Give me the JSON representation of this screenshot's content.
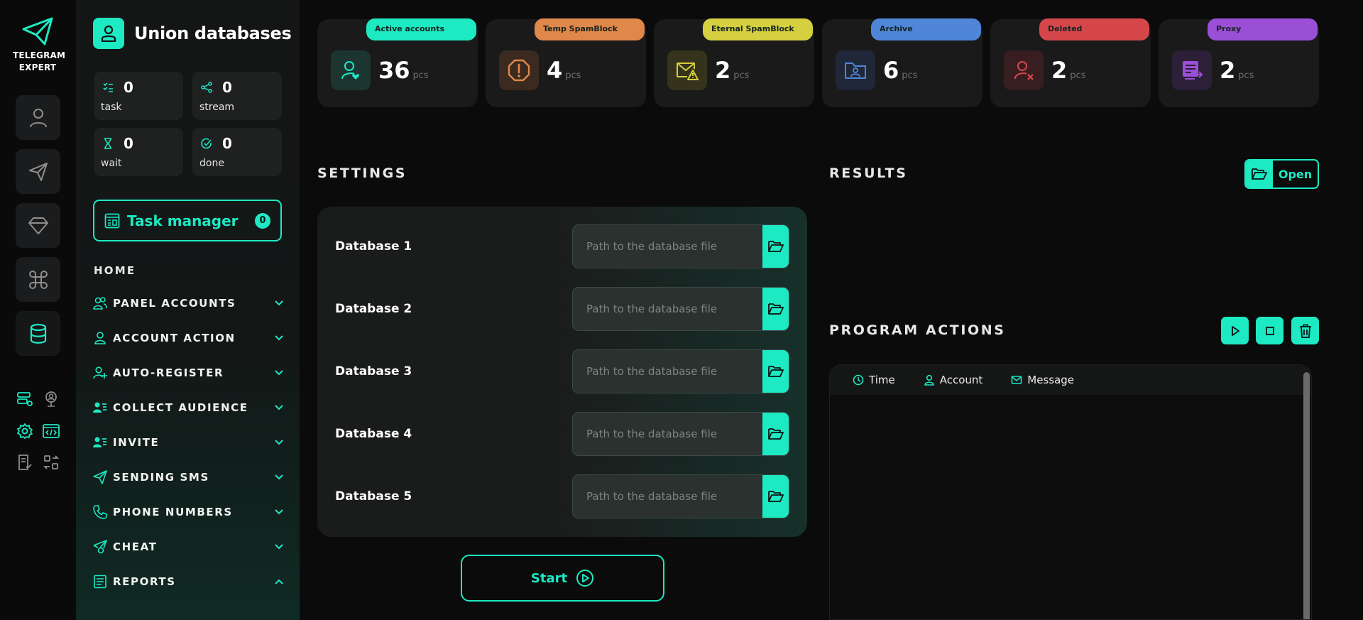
{
  "app": {
    "logo_line1": "TELEGRAM",
    "logo_line2": "EXPERT"
  },
  "sidebar": {
    "title": "Union databases",
    "stats": [
      {
        "value": "0",
        "label": "task",
        "icon": "list-icon"
      },
      {
        "value": "0",
        "label": "stream",
        "icon": "share-icon"
      },
      {
        "value": "0",
        "label": "wait",
        "icon": "hourglass-icon"
      },
      {
        "value": "0",
        "label": "done",
        "icon": "check-circle-icon"
      }
    ],
    "task_manager": {
      "label": "Task manager",
      "count": "0"
    },
    "home_label": "HOME",
    "nav": [
      {
        "label": "PANEL ACCOUNTS",
        "icon": "users-icon",
        "expanded": false
      },
      {
        "label": "ACCOUNT ACTION",
        "icon": "user-icon",
        "expanded": false
      },
      {
        "label": "AUTO-REGISTER",
        "icon": "user-plus-icon",
        "expanded": false
      },
      {
        "label": "COLLECT AUDIENCE",
        "icon": "user-list-icon",
        "expanded": false
      },
      {
        "label": "INVITE",
        "icon": "user-list-icon",
        "expanded": false
      },
      {
        "label": "SENDING SMS",
        "icon": "send-icon",
        "expanded": false
      },
      {
        "label": "PHONE NUMBERS",
        "icon": "phone-icon",
        "expanded": false
      },
      {
        "label": "CHEAT",
        "icon": "send-gear-icon",
        "expanded": false
      },
      {
        "label": "REPORTS",
        "icon": "report-icon",
        "expanded": true
      }
    ]
  },
  "cards": [
    {
      "badge": "Active accounts",
      "value": "36",
      "unit": "pcs",
      "color": "#1de9c3",
      "icon": "user-heart-icon"
    },
    {
      "badge": "Temp SpamBlock",
      "value": "4",
      "unit": "pcs",
      "color": "#e0874a",
      "icon": "warning-octagon-icon"
    },
    {
      "badge": "Eternal SpamBlock",
      "value": "2",
      "unit": "pcs",
      "color": "#d6cf3f",
      "icon": "mail-warning-icon"
    },
    {
      "badge": "Archive",
      "value": "6",
      "unit": "pcs",
      "color": "#4f86d8",
      "icon": "folder-user-icon"
    },
    {
      "badge": "Deleted",
      "value": "2",
      "unit": "pcs",
      "color": "#d6474c",
      "icon": "user-x-icon"
    },
    {
      "badge": "Proxy",
      "value": "2",
      "unit": "pcs",
      "color": "#9a4fd6",
      "icon": "proxy-icon"
    }
  ],
  "settings": {
    "title": "SETTINGS",
    "databases": [
      {
        "label": "Database 1",
        "value": "",
        "placeholder": "Path to the database file"
      },
      {
        "label": "Database 2",
        "value": "",
        "placeholder": "Path to the database file"
      },
      {
        "label": "Database 3",
        "value": "",
        "placeholder": "Path to the database file"
      },
      {
        "label": "Database 4",
        "value": "",
        "placeholder": "Path to the database file"
      },
      {
        "label": "Database 5",
        "value": "",
        "placeholder": "Path to the database file"
      }
    ],
    "start_label": "Start"
  },
  "results": {
    "title": "RESULTS",
    "open_label": "Open"
  },
  "program_actions": {
    "title": "PROGRAM ACTIONS",
    "columns": [
      "Time",
      "Account",
      "Message"
    ]
  }
}
